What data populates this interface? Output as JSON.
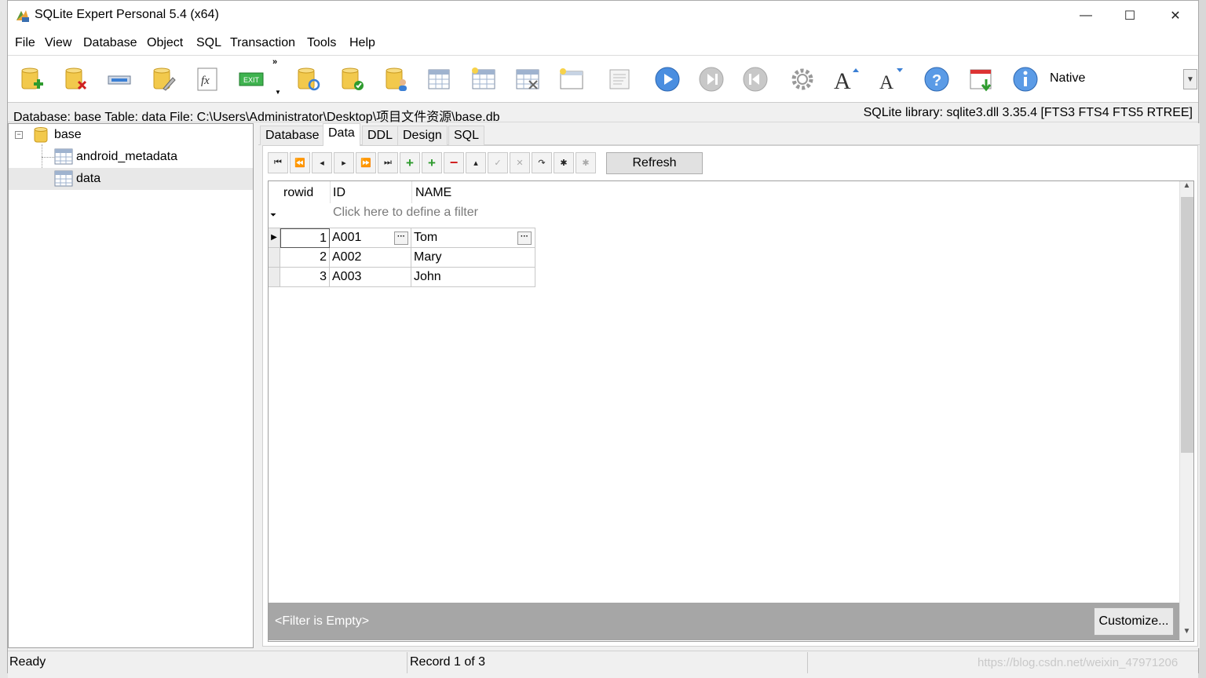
{
  "window": {
    "title": "SQLite Expert Personal 5.4 (x64)",
    "controls": {
      "minimize": "—",
      "maximize": "☐",
      "close": "✕"
    }
  },
  "menu": [
    "File",
    "View",
    "Database",
    "Object",
    "SQL",
    "Transaction",
    "Tools",
    "Help"
  ],
  "toolbar": {
    "icons": [
      "new-database-icon",
      "close-database-icon",
      "attach-database-icon",
      "edit-database-icon",
      "function-icon",
      "exit-icon",
      "database-refresh-icon",
      "database-ok-icon",
      "database-user-icon",
      "table-settings-icon",
      "new-table-icon",
      "delete-table-icon",
      "new-view-icon",
      "script-icon",
      "play-icon",
      "next-icon",
      "previous-icon",
      "settings-icon",
      "font-increase-icon",
      "font-decrease-icon",
      "help-icon",
      "download-icon",
      "info-icon"
    ],
    "mode_label": "Native",
    "more": "»"
  },
  "infobar": {
    "left": "Database: base   Table: data   File: C:\\Users\\Administrator\\Desktop\\项目文件资源\\base.db",
    "right": "SQLite library: sqlite3.dll 3.35.4 [FTS3 FTS4 FTS5 RTREE]"
  },
  "tree": {
    "root": "base",
    "items": [
      "android_metadata",
      "data"
    ],
    "selected": "data"
  },
  "tabs": [
    "Database",
    "Data",
    "DDL",
    "Design",
    "SQL"
  ],
  "active_tab": "Data",
  "grid": {
    "refresh_label": "Refresh",
    "columns": [
      "rowid",
      "ID",
      "NAME"
    ],
    "filter_placeholder": "Click here to define a filter",
    "rows": [
      {
        "rowid": "1",
        "id": "A001",
        "name": "Tom"
      },
      {
        "rowid": "2",
        "id": "A002",
        "name": "Mary"
      },
      {
        "rowid": "3",
        "id": "A003",
        "name": "John"
      }
    ],
    "filter_status": "<Filter is Empty>",
    "customize_label": "Customize..."
  },
  "status": {
    "left": "Ready",
    "record": "Record 1 of 3"
  },
  "watermark": "https://blog.csdn.net/weixin_47971206",
  "colors": {
    "accent_blue": "#3b7fd4",
    "green": "#2e9b2e",
    "red": "#d02020",
    "db_yellow": "#f2c94c"
  }
}
